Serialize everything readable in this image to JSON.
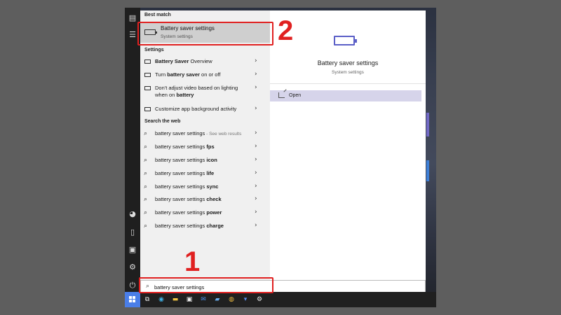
{
  "best_match": {
    "section_title": "Best match",
    "title": "Battery saver settings",
    "subtitle": "System settings"
  },
  "settings": {
    "section_title": "Settings",
    "items": [
      {
        "pre": "",
        "bold": "Battery Saver",
        "post": " Overview"
      },
      {
        "pre": "Turn ",
        "bold": "battery saver",
        "post": " on or off"
      },
      {
        "line1": "Don't adjust video based on lighting",
        "line2_pre": "when on ",
        "line2_bold": "battery"
      },
      {
        "pre": "Customize app background activity",
        "bold": "",
        "post": ""
      }
    ]
  },
  "web": {
    "section_title": "Search the web",
    "items": [
      {
        "base": "battery saver settings",
        "bold": "",
        "muted": " - See web results"
      },
      {
        "base": "battery saver settings ",
        "bold": "fps",
        "muted": ""
      },
      {
        "base": "battery saver settings ",
        "bold": "icon",
        "muted": ""
      },
      {
        "base": "battery saver settings ",
        "bold": "life",
        "muted": ""
      },
      {
        "base": "battery saver settings ",
        "bold": "sync",
        "muted": ""
      },
      {
        "base": "battery saver settings ",
        "bold": "check",
        "muted": ""
      },
      {
        "base": "battery saver settings ",
        "bold": "power",
        "muted": ""
      },
      {
        "base": "battery saver settings ",
        "bold": "charge",
        "muted": ""
      }
    ]
  },
  "preview": {
    "title": "Battery saver settings",
    "subtitle": "System settings",
    "open_label": "Open"
  },
  "search": {
    "value": "battery saver settings"
  },
  "annotations": {
    "step1": "1",
    "step2": "2",
    "color": "#e02020"
  },
  "colors": {
    "accent": "#5b5fc7",
    "selected_action": "#d6d4ea",
    "start_button": "#4a7ee8"
  },
  "icons": {
    "best_match": "battery-icon",
    "setting_row": "battery-small-icon",
    "web_row": "search-icon",
    "chevron": "chevron-right-icon",
    "open": "open-icon"
  }
}
